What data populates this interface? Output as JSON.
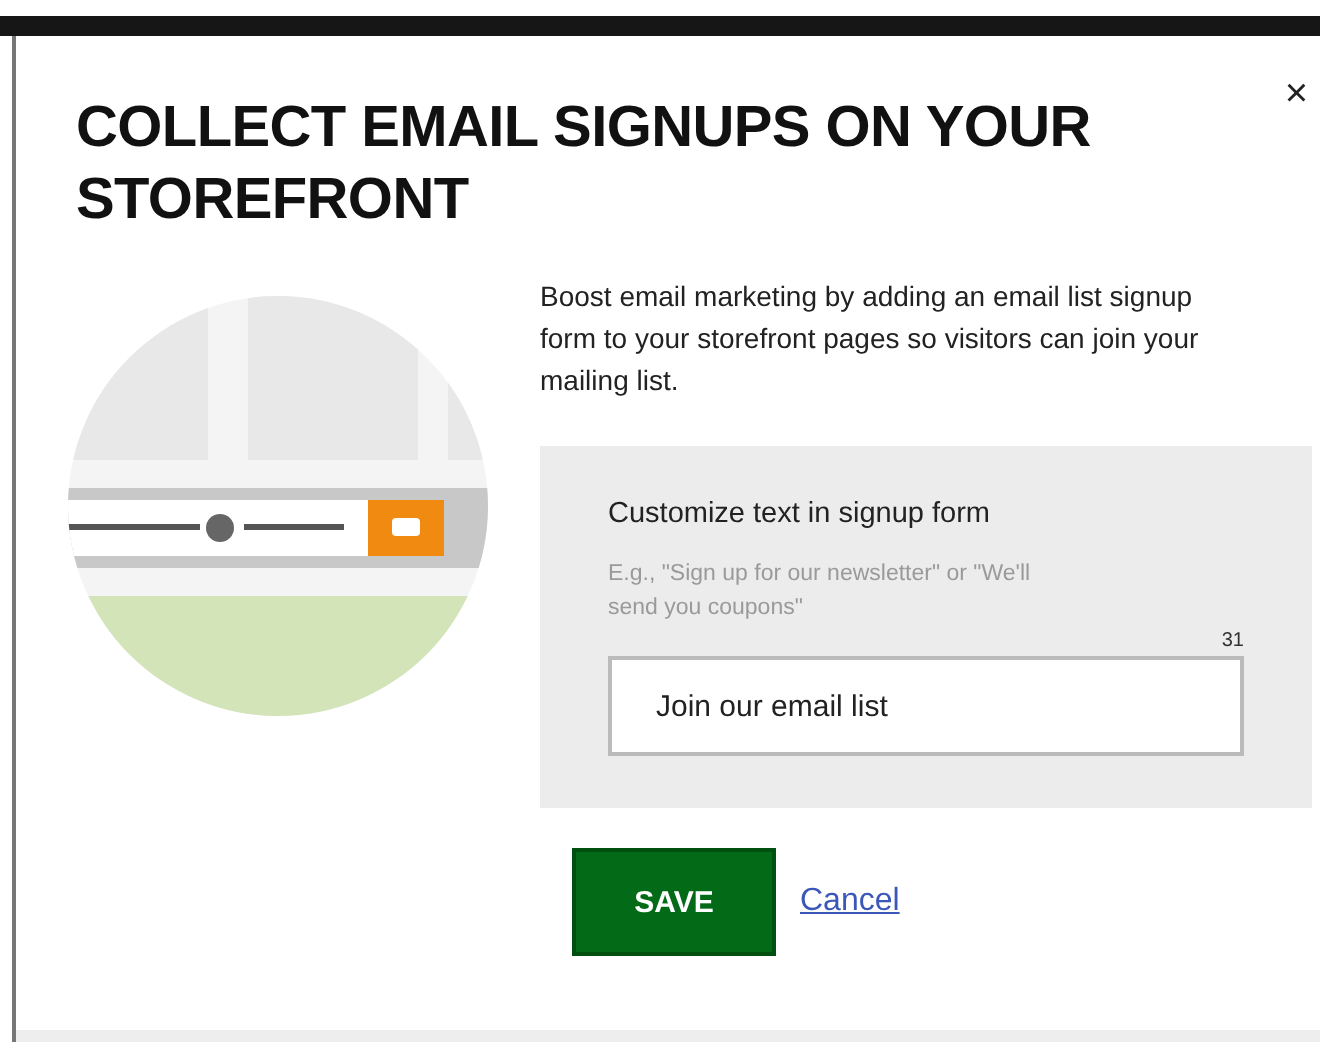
{
  "dialog": {
    "title": "COLLECT EMAIL SIGNUPS ON YOUR STOREFRONT",
    "close": "×",
    "description": "Boost email marketing by adding an email list signup form to your storefront pages so visitors can join your mailing list.",
    "form": {
      "label": "Customize text in signup form",
      "hint": "E.g., \"Sign up for our newsletter\" or \"We'll send you coupons\"",
      "counter": "31",
      "value": "Join our email list"
    },
    "buttons": [
      {
        "kind": "primary",
        "label": "SAVE"
      },
      {
        "kind": "link",
        "label": "Cancel"
      }
    ]
  }
}
